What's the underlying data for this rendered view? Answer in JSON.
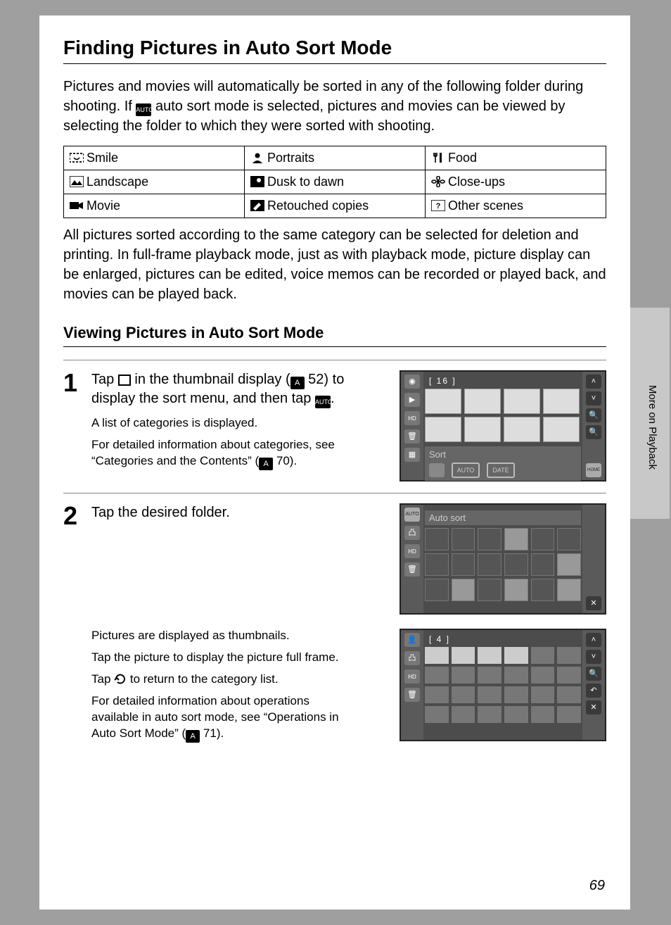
{
  "title": "Finding Pictures in Auto Sort Mode",
  "intro_a": "Pictures and movies will automatically be sorted in any of the following folder during shooting. If ",
  "intro_b": " auto sort mode is selected, pictures and movies can be viewed by selecting the folder to which they were sorted with shooting.",
  "categories": {
    "r1c1": "Smile",
    "r1c2": "Portraits",
    "r1c3": "Food",
    "r2c1": "Landscape",
    "r2c2": "Dusk to dawn",
    "r2c3": "Close-ups",
    "r3c1": "Movie",
    "r3c2": "Retouched copies",
    "r3c3": "Other scenes"
  },
  "after_table": "All pictures sorted according to the same category can be selected for deletion and printing. In full-frame playback mode, just as with playback mode, picture display can be enlarged, pictures can be edited, voice memos can be recorded or played back, and movies can be played back.",
  "heading2": "Viewing Pictures in Auto Sort Mode",
  "steps": {
    "s1": {
      "num": "1",
      "lead_a": "Tap ",
      "lead_b": " in the thumbnail display (",
      "ref1": "52",
      "lead_c": ") to display the sort menu, and then tap ",
      "lead_d": ".",
      "sub1": "A list of categories is displayed.",
      "sub2_a": "For detailed information about categories, see “Categories and the Contents” (",
      "ref2": "70",
      "sub2_b": ")."
    },
    "s2": {
      "num": "2",
      "lead": "Tap the desired folder.",
      "sub1": "Pictures are displayed as thumbnails.",
      "sub2": "Tap the picture to display the picture full frame.",
      "sub3_a": "Tap ",
      "sub3_b": " to return to the category list.",
      "sub4_a": "For detailed information about operations available in auto sort mode, see “Operations in Auto Sort Mode” (",
      "ref3": "71",
      "sub4_b": ")."
    }
  },
  "screen1": {
    "count": "[    16 ]",
    "band_label": "Sort",
    "pill_auto": "AUTO",
    "pill_date": "DATE",
    "home": "HOME"
  },
  "screen2": {
    "title": "Auto sort"
  },
  "screen3": {
    "count": "[     4 ]"
  },
  "side_label": "More on Playback",
  "page_number": "69"
}
